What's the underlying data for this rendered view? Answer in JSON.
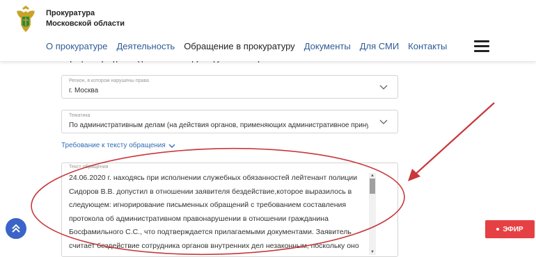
{
  "header": {
    "org_line1": "Прокуратура",
    "org_line2": "Московской области",
    "nav": [
      {
        "label": "О прокуратуре"
      },
      {
        "label": "Деятельность"
      },
      {
        "label": "Обращение в прокуратуру"
      },
      {
        "label": "Документы"
      },
      {
        "label": "Для СМИ"
      },
      {
        "label": "Контакты"
      }
    ],
    "menu_icon": "hamburger-icon"
  },
  "form": {
    "title": "Обращение гражданина (физического лица) о нарушении его прав",
    "region": {
      "label": "Регион, в котором нарушены права",
      "value": "г. Москва"
    },
    "topic": {
      "label": "Тематика",
      "value": "По административным делам (на действия органов, применяющих административное принуждение, в т.ч. Г..."
    },
    "requirements_link": "Требование к тексту обращения",
    "text": {
      "label": "Текст обращения",
      "lines": [
        "24.06.2020 г. находясь при исполнении служебных обязанностей лейтенант полиции",
        "Сидоров В.В. допустил в отношении заявителя бездействие,которое выразилось в",
        "следующем:  игнорирование письменных обращений с требованием   составления",
        "протокола об административном правонарушении в отношении гражданина",
        "Босфамильного С.С., что подтверждается прилагаемыми документами. Заявитель",
        "считает бездействие сотрудника органов внутренних дел незаконным, поскольку оно"
      ]
    }
  },
  "buttons": {
    "efir": "ЭФИР"
  },
  "colors": {
    "nav_link": "#2f5a95",
    "efir_bg": "#e54043",
    "up_button": "#3b63c8",
    "annotation": "#c8373b"
  }
}
